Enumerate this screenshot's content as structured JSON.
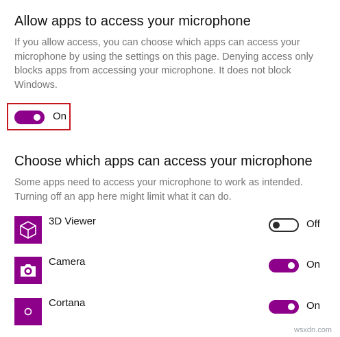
{
  "microphone_access": {
    "title": "Allow apps to access your microphone",
    "description": "If you allow access, you can choose which apps can access your microphone by using the settings on this page. Denying access only blocks apps from accessing your microphone. It does not block Windows.",
    "toggle_state": "On",
    "toggle_on": true
  },
  "app_access": {
    "title": "Choose which apps can access your microphone",
    "description": "Some apps need to access your microphone to work as intended. Turning off an app here might limit what it can do.",
    "apps": [
      {
        "name": "3D Viewer",
        "icon": "3d-viewer-icon",
        "state": "Off",
        "on": false
      },
      {
        "name": "Camera",
        "icon": "camera-icon",
        "state": "On",
        "on": true
      },
      {
        "name": "Cortana",
        "icon": "cortana-icon",
        "state": "On",
        "on": true
      }
    ]
  },
  "watermark": "wsxdn.com",
  "colors": {
    "accent": "#8d008a",
    "highlight_border": "#c5161d",
    "description_text": "#757575"
  }
}
